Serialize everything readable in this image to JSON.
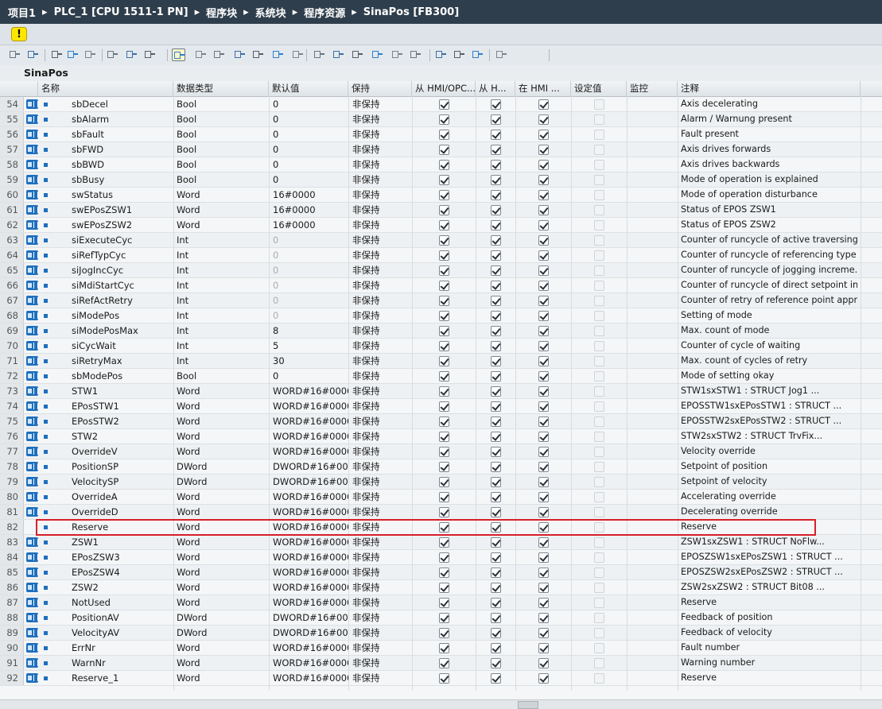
{
  "breadcrumb": [
    "项目1",
    "PLC_1 [CPU 1511-1 PN]",
    "程序块",
    "系统块",
    "程序资源",
    "SinaPos [FB300]"
  ],
  "block_title": "SinaPos",
  "warning_icon": "warning-icon",
  "toolbar_icons": [
    "insert-row-icon",
    "add-row-icon",
    "expand-icon",
    "collapse-icon",
    "snapshot-icon",
    "list-view-icon",
    "tree-view-icon",
    "load-icon",
    "favorites-icon",
    "monitor-icon",
    "monitor-all-icon",
    "breakpoint-icon",
    "step-icon",
    "jump-icon",
    "indent-icon",
    "outdent-icon",
    "align-icon",
    "column-icon",
    "bookmark-icon",
    "prev-bookmark-icon",
    "next-bookmark-icon",
    "zoom-icon",
    "compare-icon",
    "call-icon",
    "database-icon"
  ],
  "columns": {
    "name": "名称",
    "type": "数据类型",
    "default": "默认值",
    "retain": "保持",
    "hmi_opc": "从 HMI/OPC...",
    "hmi2": "从 H...",
    "hmi3": "在 HMI ...",
    "setpoint": "设定值",
    "monitor": "监控",
    "comment": "注释"
  },
  "rows": [
    {
      "n": "54",
      "name": "sbDecel",
      "type": "Bool",
      "def": "0",
      "ret": "非保持",
      "cmt": "Axis decelerating",
      "g": false
    },
    {
      "n": "55",
      "name": "sbAlarm",
      "type": "Bool",
      "def": "0",
      "ret": "非保持",
      "cmt": "Alarm / Warnung present",
      "g": false
    },
    {
      "n": "56",
      "name": "sbFault",
      "type": "Bool",
      "def": "0",
      "ret": "非保持",
      "cmt": "Fault present",
      "g": false
    },
    {
      "n": "57",
      "name": "sbFWD",
      "type": "Bool",
      "def": "0",
      "ret": "非保持",
      "cmt": "Axis drives forwards",
      "g": false
    },
    {
      "n": "58",
      "name": "sbBWD",
      "type": "Bool",
      "def": "0",
      "ret": "非保持",
      "cmt": "Axis drives backwards",
      "g": false
    },
    {
      "n": "59",
      "name": "sbBusy",
      "type": "Bool",
      "def": "0",
      "ret": "非保持",
      "cmt": "Mode of operation is explained",
      "g": false
    },
    {
      "n": "60",
      "name": "swStatus",
      "type": "Word",
      "def": "16#0000",
      "ret": "非保持",
      "cmt": "Mode of operation disturbance",
      "g": false
    },
    {
      "n": "61",
      "name": "swEPosZSW1",
      "type": "Word",
      "def": "16#0000",
      "ret": "非保持",
      "cmt": "Status of EPOS ZSW1",
      "g": false
    },
    {
      "n": "62",
      "name": "swEPosZSW2",
      "type": "Word",
      "def": "16#0000",
      "ret": "非保持",
      "cmt": "Status of EPOS ZSW2",
      "g": false
    },
    {
      "n": "63",
      "name": "siExecuteCyc",
      "type": "Int",
      "def": "0",
      "ret": "非保持",
      "cmt": "Counter of runcycle of active traversing ...",
      "g": true
    },
    {
      "n": "64",
      "name": "siRefTypCyc",
      "type": "Int",
      "def": "0",
      "ret": "非保持",
      "cmt": "Counter of runcycle of referencing type ...",
      "g": true
    },
    {
      "n": "65",
      "name": "siJogIncCyc",
      "type": "Int",
      "def": "0",
      "ret": "非保持",
      "cmt": "Counter of runcycle of jogging increme...",
      "g": true
    },
    {
      "n": "66",
      "name": "siMdiStartCyc",
      "type": "Int",
      "def": "0",
      "ret": "非保持",
      "cmt": "Counter of runcycle of direct setpoint in...",
      "g": true
    },
    {
      "n": "67",
      "name": "siRefActRetry",
      "type": "Int",
      "def": "0",
      "ret": "非保持",
      "cmt": "Counter of retry of reference point appr...",
      "g": true
    },
    {
      "n": "68",
      "name": "siModePos",
      "type": "Int",
      "def": "0",
      "ret": "非保持",
      "cmt": "Setting of mode",
      "g": true
    },
    {
      "n": "69",
      "name": "siModePosMax",
      "type": "Int",
      "def": "8",
      "ret": "非保持",
      "cmt": "Max. count of mode",
      "g": false
    },
    {
      "n": "70",
      "name": "siCycWait",
      "type": "Int",
      "def": "5",
      "ret": "非保持",
      "cmt": "Counter of cycle of waiting",
      "g": false
    },
    {
      "n": "71",
      "name": "siRetryMax",
      "type": "Int",
      "def": "30",
      "ret": "非保持",
      "cmt": "Max. count of cycles of retry",
      "g": false
    },
    {
      "n": "72",
      "name": "sbModePos",
      "type": "Bool",
      "def": "0",
      "ret": "非保持",
      "cmt": "Mode of setting okay",
      "g": false
    },
    {
      "n": "73",
      "name": "STW1",
      "type": "Word",
      "def": "WORD#16#0000",
      "ret": "非保持",
      "cmt": "STW1sxSTW1     : STRUCT          Jog1       ...",
      "g": false
    },
    {
      "n": "74",
      "name": "EPosSTW1",
      "type": "Word",
      "def": "WORD#16#0000",
      "ret": "非保持",
      "cmt": "EPOSSTW1sxEPosSTW1   : STRUCT          ...",
      "g": false
    },
    {
      "n": "75",
      "name": "EPosSTW2",
      "type": "Word",
      "def": "WORD#16#0000",
      "ret": "非保持",
      "cmt": "EPOSSTW2sxEPosSTW2   : STRUCT          ...",
      "g": false
    },
    {
      "n": "76",
      "name": "STW2",
      "type": "Word",
      "def": "WORD#16#0000",
      "ret": "非保持",
      "cmt": "STW2sxSTW2        : STRUCT           TrvFix...",
      "g": false
    },
    {
      "n": "77",
      "name": "OverrideV",
      "type": "Word",
      "def": "WORD#16#0000",
      "ret": "非保持",
      "cmt": "Velocity override",
      "g": false
    },
    {
      "n": "78",
      "name": "PositionSP",
      "type": "DWord",
      "def": "DWORD#16#00...",
      "ret": "非保持",
      "cmt": "Setpoint of position",
      "g": false
    },
    {
      "n": "79",
      "name": "VelocitySP",
      "type": "DWord",
      "def": "DWORD#16#00...",
      "ret": "非保持",
      "cmt": "Setpoint of velocity",
      "g": false
    },
    {
      "n": "80",
      "name": "OverrideA",
      "type": "Word",
      "def": "WORD#16#0000",
      "ret": "非保持",
      "cmt": "Accelerating override",
      "g": false
    },
    {
      "n": "81",
      "name": "OverrideD",
      "type": "Word",
      "def": "WORD#16#0000",
      "ret": "非保持",
      "cmt": "Decelerating override",
      "g": false
    },
    {
      "n": "82",
      "name": "Reserve",
      "type": "Word",
      "def": "WORD#16#0000",
      "ret": "非保持",
      "cmt": "Reserve",
      "g": false
    },
    {
      "n": "83",
      "name": "ZSW1",
      "type": "Word",
      "def": "WORD#16#0000",
      "ret": "非保持",
      "cmt": "ZSW1sxZSW1        : STRUCT          NoFlw...",
      "g": false
    },
    {
      "n": "84",
      "name": "EPosZSW3",
      "type": "Word",
      "def": "WORD#16#0000",
      "ret": "非保持",
      "cmt": "EPOSZSW1sxEPosZSW1   : STRUCT          ...",
      "g": false
    },
    {
      "n": "85",
      "name": "EPosZSW4",
      "type": "Word",
      "def": "WORD#16#0000",
      "ret": "非保持",
      "cmt": "EPOSZSW2sxEPosZSW2   : STRUCT          ...",
      "g": false
    },
    {
      "n": "86",
      "name": "ZSW2",
      "type": "Word",
      "def": "WORD#16#0000",
      "ret": "非保持",
      "cmt": "ZSW2sxZSW2     : STRUCT          Bit08      ...",
      "g": false
    },
    {
      "n": "87",
      "name": "NotUsed",
      "type": "Word",
      "def": "WORD#16#0000",
      "ret": "非保持",
      "cmt": "Reserve",
      "g": false
    },
    {
      "n": "88",
      "name": "PositionAV",
      "type": "DWord",
      "def": "DWORD#16#00...",
      "ret": "非保持",
      "cmt": "Feedback of position",
      "g": false
    },
    {
      "n": "89",
      "name": "VelocityAV",
      "type": "DWord",
      "def": "DWORD#16#00...",
      "ret": "非保持",
      "cmt": "Feedback of velocity",
      "g": false
    },
    {
      "n": "90",
      "name": "ErrNr",
      "type": "Word",
      "def": "WORD#16#0000",
      "ret": "非保持",
      "cmt": "Fault number",
      "g": false
    },
    {
      "n": "91",
      "name": "WarnNr",
      "type": "Word",
      "def": "WORD#16#0000",
      "ret": "非保持",
      "cmt": "Warning number",
      "g": false
    },
    {
      "n": "92",
      "name": "Reserve_1",
      "type": "Word",
      "def": "WORD#16#0000",
      "ret": "非保持",
      "cmt": "Reserve",
      "g": false
    }
  ],
  "highlighted_row": "82",
  "colors": {
    "highlight": "#d8202a",
    "titlebar": "#2f3e4c",
    "icon_blue": "#1f6fbd"
  }
}
